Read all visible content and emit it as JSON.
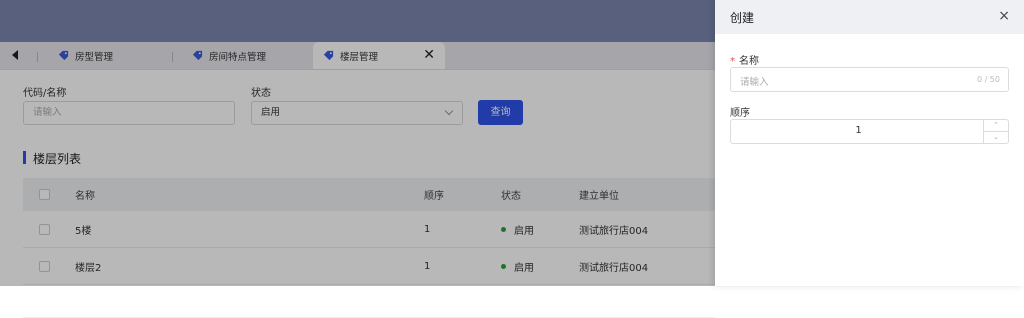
{
  "tabs": [
    {
      "label": "房型管理",
      "active": false
    },
    {
      "label": "房间特点管理",
      "active": false
    },
    {
      "label": "楼层管理",
      "active": true
    }
  ],
  "filters": {
    "code_label": "代码/名称",
    "code_placeholder": "请输入",
    "status_label": "状态",
    "status_value": "启用",
    "query_button": "查询"
  },
  "list": {
    "title": "楼层列表",
    "columns": [
      "名称",
      "顺序",
      "状态",
      "建立单位"
    ],
    "rows": [
      {
        "name": "5楼",
        "order": "1",
        "status": "启用",
        "unit": "测试旅行店004"
      },
      {
        "name": "楼层2",
        "order": "1",
        "status": "启用",
        "unit": "测试旅行店004"
      }
    ]
  },
  "drawer": {
    "title": "创建",
    "close": "×",
    "name_label": "名称",
    "required_mark": "*",
    "name_placeholder": "请输入",
    "name_counter": "0 / 50",
    "order_label": "顺序",
    "order_value": "1",
    "step_up": "⌃",
    "step_down": "⌄"
  },
  "colors": {
    "primary": "#2f54eb",
    "status_enabled": "#2e9b3c",
    "topbar": "#7b86ad"
  }
}
